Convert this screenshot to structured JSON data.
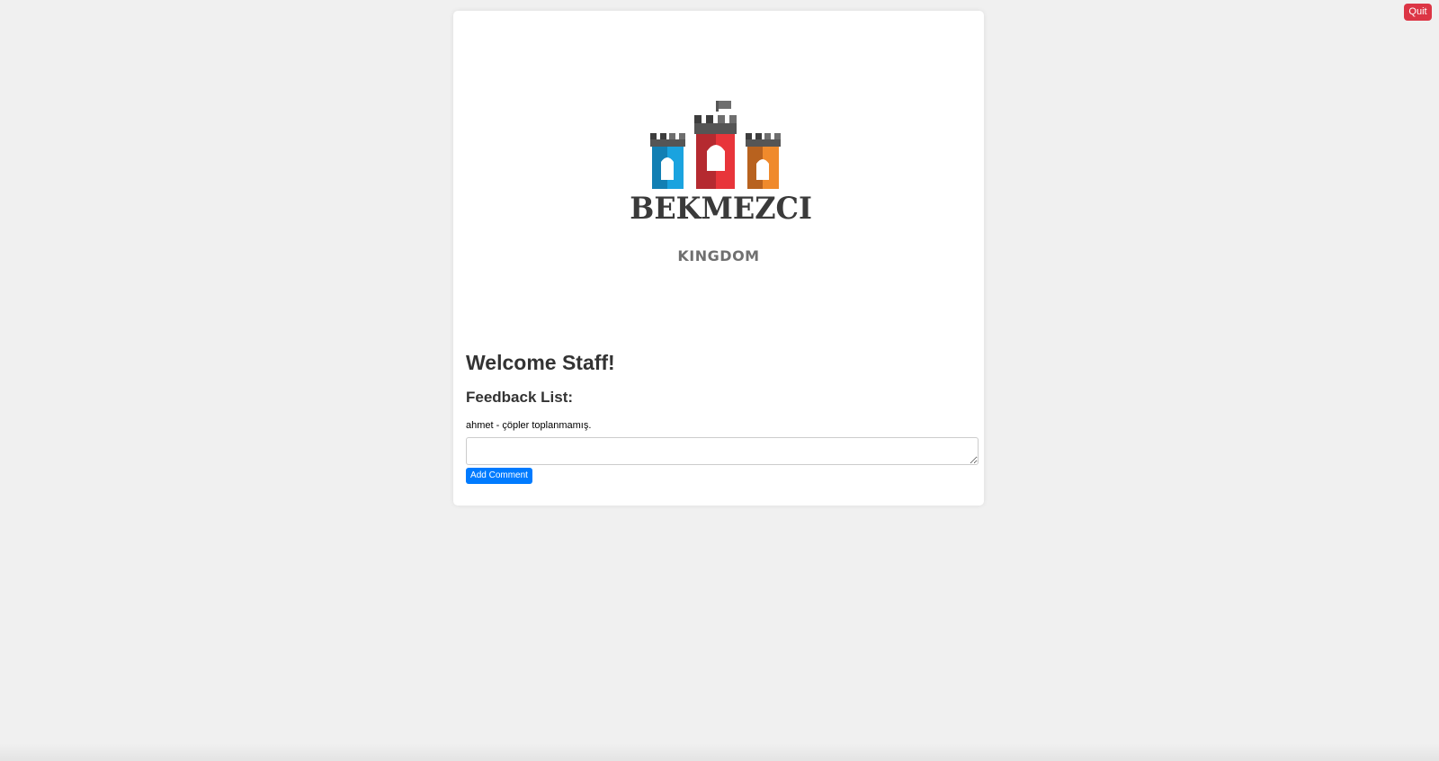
{
  "header": {
    "quit_label": "Quit"
  },
  "logo": {
    "wordmark": "BEKMEZCI",
    "subtitle": "KINGDOM"
  },
  "main": {
    "welcome_title": "Welcome Staff!",
    "feedback_heading": "Feedback List:",
    "feedback_items": [
      {
        "text": "ahmet - çöpler toplanmamış."
      }
    ],
    "comment_placeholder": "",
    "add_comment_label": "Add Comment"
  },
  "colors": {
    "quit": "#dc3545",
    "primary": "#007bff",
    "background": "#f0f0f0",
    "tower_left": "#1aa3df",
    "tower_center": "#e8353a",
    "tower_right": "#f08a2c",
    "battlement": "#555555"
  }
}
